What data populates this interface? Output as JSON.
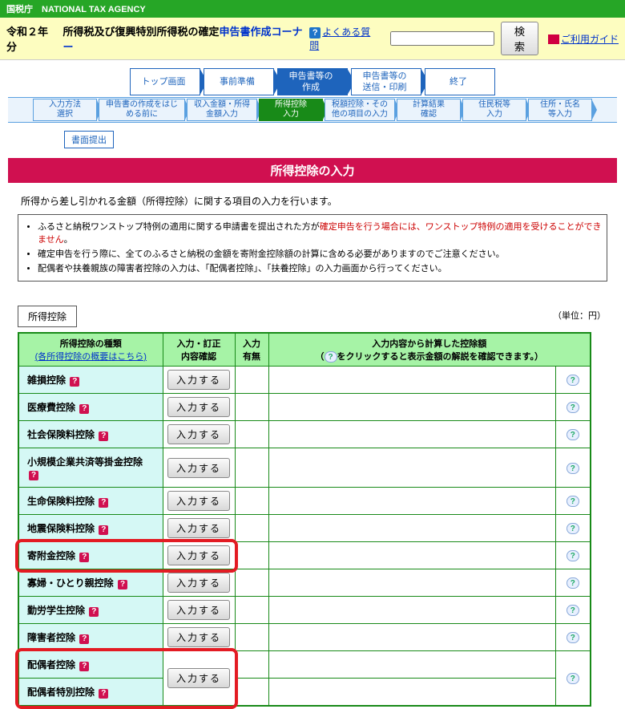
{
  "top_bar": "国税庁　NATIONAL TAX AGENCY",
  "title": {
    "year": "令和２年分",
    "main": "所得税及び復興特別所得税の確定",
    "suffix": "申告書作成コーナー",
    "faq": "よくある質問",
    "search": "検 索",
    "guide": "ご利用ガイド"
  },
  "flow": [
    "トップ画面",
    "事前準備",
    "申告書等の\n作成",
    "申告書等の\n送信・印刷",
    "終了"
  ],
  "subflow": [
    "入力方法\n選択",
    "申告書の作成をはじ\nめる前に",
    "収入金額・所得\n金額入力",
    "所得控除\n入力",
    "税額控除・その\n他の項目の入力",
    "計算結果\n確認",
    "住民税等\n入力",
    "住所・氏名\n等入力"
  ],
  "doc_submit": "書面提出",
  "header": "所得控除の入力",
  "desc1": "所得から差し引かれる金額（所得控除）に関する項目の入力を行います。",
  "notes": [
    {
      "prefix": "ふるさと納税ワンストップ特例の適用に関する申請書を提出された方が",
      "red": "確定申告を行う場合には、ワンストップ特例の適用を受けることができません",
      "suffix": "。"
    },
    {
      "text": "確定申告を行う際に、全てのふるさと納税の金額を寄附金控除額の計算に含める必要がありますのでご注意ください。"
    },
    {
      "text": "配偶者や扶養親族の障害者控除の入力は、「配偶者控除」、「扶養控除」の入力画面から行ってください。"
    }
  ],
  "section_label": "所得控除",
  "unit": "（単位：円）",
  "table": {
    "header": {
      "name": "所得控除の種類",
      "name_link": "(各所得控除の概要はこちら)",
      "input": "入力・訂正\n内容確認",
      "flag": "入力\n有無",
      "val": "入力内容から計算した控除額",
      "val_sub_prefix": "（",
      "val_sub_suffix": "をクリックすると表示金額の解説を確認できます。）"
    },
    "input_btn": "入力する",
    "rows": [
      {
        "label": "雑損控除"
      },
      {
        "label": "医療費控除"
      },
      {
        "label": "社会保険料控除"
      },
      {
        "label": "小規模企業共済等掛金控除"
      },
      {
        "label": "生命保険料控除"
      },
      {
        "label": "地震保険料控除"
      },
      {
        "label": "寄附金控除",
        "highlight": true
      },
      {
        "label": "寡婦・ひとり親控除"
      },
      {
        "label": "勤労学生控除"
      },
      {
        "label": "障害者控除"
      },
      {
        "label": "配偶者控除",
        "spouse": true,
        "highlight": true
      },
      {
        "label": "配偶者特別控除",
        "spouse": true
      }
    ]
  }
}
